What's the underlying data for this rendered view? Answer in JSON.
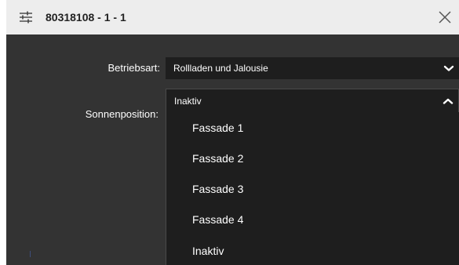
{
  "dialog": {
    "title": "80318108 - 1 - 1",
    "settings_icon": "sliders-icon",
    "close_icon": "close-icon"
  },
  "form": {
    "betriebsart": {
      "label": "Betriebsart:",
      "value": "Rollladen und Jalousie",
      "chevron": "chevron-down-icon"
    },
    "sonnenposition": {
      "label": "Sonnenposition:",
      "value": "Inaktiv",
      "chevron": "chevron-up-icon",
      "expanded": true,
      "options": [
        "Fassade 1",
        "Fassade 2",
        "Fassade 3",
        "Fassade 4",
        "Inaktiv"
      ]
    }
  },
  "colors": {
    "titlebar_bg": "#ededed",
    "dialog_bg": "#333333",
    "field_bg": "#1e1e1e",
    "text": "#ffffff"
  }
}
